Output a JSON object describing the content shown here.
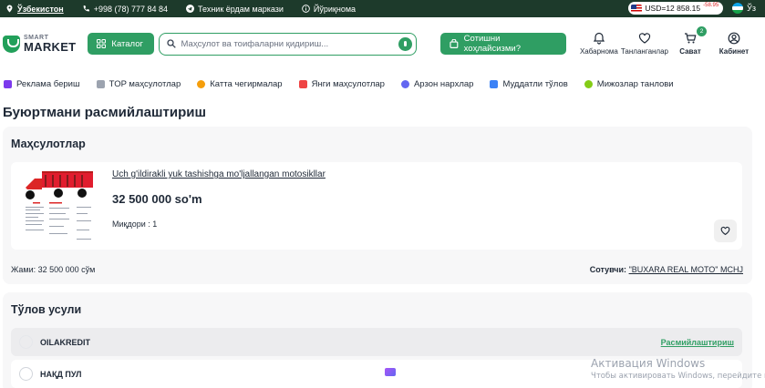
{
  "topbar": {
    "location": "Ўзбекистон",
    "phone": "+998 (78) 777 84 84",
    "support": "Техник ёрдам маркази",
    "guide": "Йўриқнома",
    "usd_rate": "USD=12 858.15",
    "usd_delta": "-58.95",
    "language": "Ўз"
  },
  "header": {
    "logo_top": "SMART",
    "logo_bottom": "MARKET",
    "catalog_label": "Каталог",
    "search_placeholder": "Маҳсулот ва тоифаларни қидириш...",
    "sell_label": "Сотишни хоҳлайсизми?",
    "icons": [
      {
        "label": "Хабарнома",
        "icon": "bell-icon"
      },
      {
        "label": "Танланганлар",
        "icon": "heart-icon"
      },
      {
        "label": "Сават",
        "icon": "cart-icon",
        "badge": "2"
      },
      {
        "label": "Кабинет",
        "icon": "user-icon"
      }
    ]
  },
  "nav": [
    {
      "label": "Реклама бериш",
      "color": "#7c3aed"
    },
    {
      "label": "TOP маҳсулотлар",
      "color": "#9ca3af"
    },
    {
      "label": "Катта чегирмалар",
      "color": "#f59e0b"
    },
    {
      "label": "Янги маҳсулотлар",
      "color": "#ef4444"
    },
    {
      "label": "Арзон нархлар",
      "color": "#6366f1"
    },
    {
      "label": "Муддатли тўлов",
      "color": "#3b82f6"
    },
    {
      "label": "Мижозлар танлови",
      "color": "#84cc16"
    }
  ],
  "page_title": "Буюртмани расмийлаштириш",
  "products": {
    "title": "Маҳсулотлар",
    "item": {
      "name": "Uch g'ildirakli yuk tashishga mo'ljallangan motosikllar",
      "price": "32 500 000 so'm",
      "qty": "Миқдори : 1"
    },
    "total": "Жами: 32 500 000 сўм",
    "seller_label": "Сотувчи:",
    "seller_name": "\"BUXARA REAL MOTO\" MCHJ"
  },
  "payment": {
    "title": "Тўлов усули",
    "options": [
      {
        "label": "OILAKREDIT",
        "action": "Расмийлаштириш"
      },
      {
        "label": "НАҚД ПУЛ"
      }
    ]
  },
  "watermark": {
    "line1": "Активация Windows",
    "line2": "Чтобы активировать Windows, перейдите в р"
  }
}
